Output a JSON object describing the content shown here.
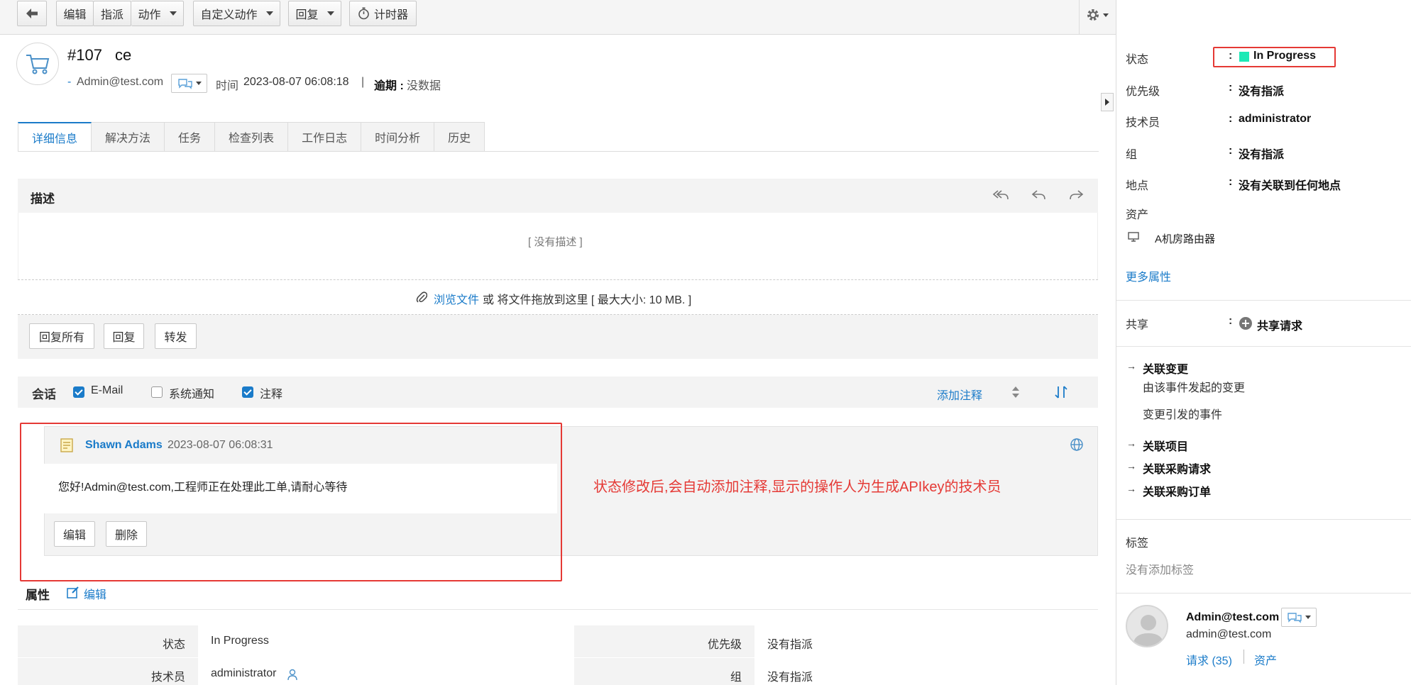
{
  "toolbar": {
    "back_label": "",
    "edit": "编辑",
    "assign": "指派",
    "actions": "动作",
    "custom_actions": "自定义动作",
    "reply": "回复",
    "timer": "计时器"
  },
  "request": {
    "id": "#107",
    "title": "ce",
    "requester_prefix": "-",
    "requester": "Admin@test.com",
    "time_label": "时间",
    "time_value": "2023-08-07 06:08:18",
    "separator": "|",
    "overdue_label": "逾期 :",
    "overdue_value": "没数据"
  },
  "tabs": [
    "详细信息",
    "解决方法",
    "任务",
    "检查列表",
    "工作日志",
    "时间分析",
    "历史"
  ],
  "description": {
    "title": "描述",
    "empty_text": "[ 没有描述 ]",
    "browse_link": "浏览文件",
    "attach_text": "或 将文件拖放到这里 [ 最大大小:  10 MB. ]",
    "buttons": [
      "回复所有",
      "回复",
      "转发"
    ]
  },
  "conversation": {
    "title": "会话",
    "filters": [
      {
        "label": "E-Mail",
        "checked": true
      },
      {
        "label": "系统通知",
        "checked": false
      },
      {
        "label": "注释",
        "checked": true
      }
    ],
    "add_note": "添加注释",
    "note": {
      "author": "Shawn Adams",
      "time": "2023-08-07 06:08:31",
      "body": "您好!Admin@test.com,工程师正在处理此工单,请耐心等待",
      "buttons": [
        "编辑",
        "删除"
      ]
    },
    "annotation": "状态修改后,会自动添加注释,显示的操作人为生成APIkey的技术员"
  },
  "properties": {
    "title": "属性",
    "edit_label": "编辑",
    "rows": [
      {
        "l1": "状态",
        "v1": "In Progress",
        "l2": "优先级",
        "v2": "没有指派"
      },
      {
        "l1": "技术员",
        "v1": "administrator",
        "l2": "组",
        "v2": "没有指派"
      }
    ]
  },
  "right_panel": {
    "fields": [
      {
        "label": "状态",
        "value": "In Progress"
      },
      {
        "label": "优先级",
        "value": "没有指派"
      },
      {
        "label": "技术员",
        "value": "administrator"
      },
      {
        "label": "组",
        "value": "没有指派"
      },
      {
        "label": "地点",
        "value": "没有关联到任何地点"
      }
    ],
    "colon": ":",
    "assets_label": "资产",
    "asset_name": "A机房路由器",
    "more_props": "更多属性",
    "share_label": "共享",
    "share_action": "共享请求",
    "links": [
      {
        "title": "关联变更",
        "subs": [
          "由该事件发起的变更",
          "变更引发的事件"
        ]
      },
      {
        "title": "关联项目",
        "subs": []
      },
      {
        "title": "关联采购请求",
        "subs": []
      },
      {
        "title": "关联采购订单",
        "subs": []
      }
    ],
    "tags_label": "标签",
    "tags_empty": "没有添加标签",
    "user_name": "Admin@test.com",
    "user_email": "admin@test.com",
    "requests_link": "请求 (35)",
    "assets_link": "资产",
    "status_color": "#1de9b6",
    "highlight_color": "#e53935"
  }
}
